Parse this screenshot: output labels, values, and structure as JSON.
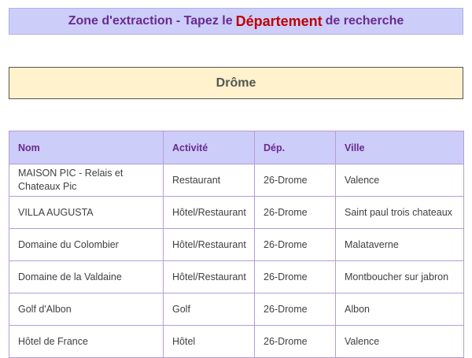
{
  "header": {
    "prefix": "Zone d'extraction - Tapez le",
    "highlight": "Département",
    "suffix": "de recherche"
  },
  "search": {
    "value": "Drôme"
  },
  "table": {
    "columns": [
      "Nom",
      "Activité",
      "Dép.",
      "Ville"
    ],
    "rows": [
      [
        "MAISON PIC - Relais et Chateaux Pic",
        "Restaurant",
        "26-Drome",
        "Valence"
      ],
      [
        "VILLA AUGUSTA",
        "Hôtel/Restaurant",
        "26-Drome",
        "Saint paul trois chateaux"
      ],
      [
        "Domaine du Colombier",
        "Hôtel/Restaurant",
        "26-Drome",
        "Malataverne"
      ],
      [
        "Domaine de la Valdaine",
        "Hôtel/Restaurant",
        "26-Drome",
        "Montboucher sur jabron"
      ],
      [
        "Golf d'Albon",
        "Golf",
        "26-Drome",
        "Albon"
      ],
      [
        "Hôtel de France",
        "Hôtel",
        "26-Drome",
        "Valence"
      ]
    ]
  },
  "colors": {
    "header_bg": "#cccdf9",
    "header_text": "#6a2a8e",
    "accent": "#c00000",
    "search_bg": "#fff2cc",
    "grid": "#b39ddb"
  }
}
